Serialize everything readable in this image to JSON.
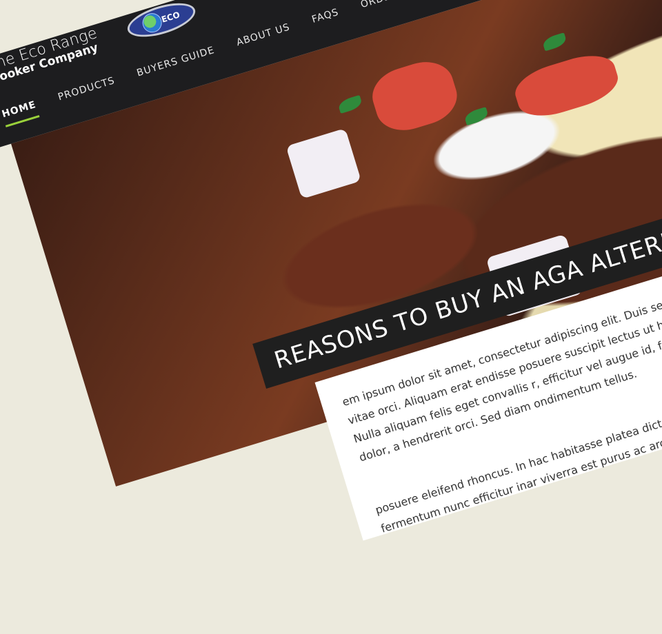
{
  "brand": {
    "line1": "The Eco Range",
    "line2": "Cooker Company",
    "logo_text": "ECO"
  },
  "nav": {
    "items": [
      {
        "label": "Home"
      },
      {
        "label": "Products"
      },
      {
        "label": "Buyers Guide"
      },
      {
        "label": "About Us"
      },
      {
        "label": "FAQs"
      },
      {
        "label": "Orde"
      }
    ]
  },
  "hero": {
    "headline": "Reasons to buy an AGA alternative"
  },
  "content": {
    "paragraph1": "em ipsum dolor sit amet, consectetur adipiscing elit. Duis sed metus nec sem tincidunt ultricies ac vitae orci. Aliquam erat endisse posuere suscipit lectus ut hendrerit. Donec faucibus aliquam sagittis. Nulla aliquam felis eget convallis r, efficitur vel augue id, fringilla luctus augue. Curabitur a dictum dolor, a hendrerit orci. Sed diam ondimentum tellus.",
    "paragraph2": "posuere eleifend rhoncus. In hac habitasse platea dictumst. Nulla onvallis. Aenean vulputate fermentum nunc efficitur inar viverra est purus ac arcu."
  },
  "colors": {
    "navbar": "#1d1d1f",
    "accent": "#9ad13b",
    "background": "#eceadd"
  }
}
